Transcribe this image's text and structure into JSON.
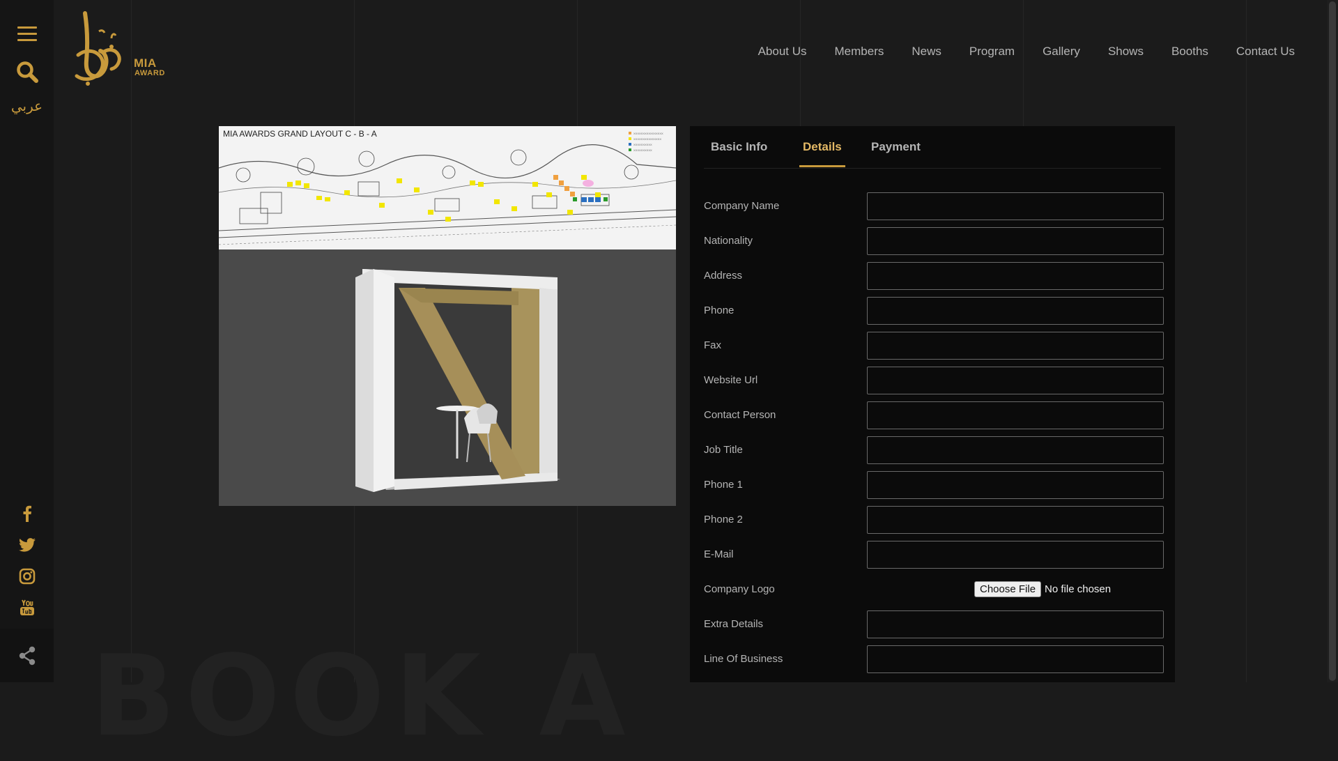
{
  "brand": {
    "logo_line1": "MIA",
    "logo_line2": "AWARD",
    "logo_icon": "calligraphy-logo-icon"
  },
  "sidebar": {
    "language": "عربي",
    "menu_icon": "hamburger-menu-icon",
    "search_icon": "search-icon",
    "social": [
      "facebook-icon",
      "twitter-icon",
      "instagram-icon",
      "youtube-icon"
    ],
    "share_icon": "share-icon"
  },
  "nav": {
    "items": [
      "About Us",
      "Members",
      "News",
      "Program",
      "Gallery",
      "Shows",
      "Booths",
      "Contact Us"
    ]
  },
  "floorplan": {
    "title": "MIA AWARDS GRAND LAYOUT C - B - A"
  },
  "tabs": [
    {
      "label": "Basic Info",
      "active": false
    },
    {
      "label": "Details",
      "active": true
    },
    {
      "label": "Payment",
      "active": false
    }
  ],
  "form": {
    "fields": [
      {
        "label": "Company Name",
        "value": ""
      },
      {
        "label": "Nationality",
        "value": ""
      },
      {
        "label": "Address",
        "value": ""
      },
      {
        "label": "Phone",
        "value": ""
      },
      {
        "label": "Fax",
        "value": ""
      },
      {
        "label": "Website Url",
        "value": ""
      },
      {
        "label": "Contact Person",
        "value": ""
      },
      {
        "label": "Job Title",
        "value": ""
      },
      {
        "label": "Phone 1",
        "value": ""
      },
      {
        "label": "Phone 2",
        "value": ""
      },
      {
        "label": "E-Mail",
        "value": ""
      },
      {
        "label": "Company Logo",
        "button": "Choose File",
        "status": "No file chosen"
      },
      {
        "label": "Extra Details",
        "value": ""
      },
      {
        "label": "Line Of Business",
        "value": ""
      }
    ]
  },
  "watermark": "BOOK A",
  "colors": {
    "gold": "#c89a3c",
    "active_tab": "#e3b865",
    "background": "#1b1b1b",
    "panel": "#0b0b0b"
  }
}
